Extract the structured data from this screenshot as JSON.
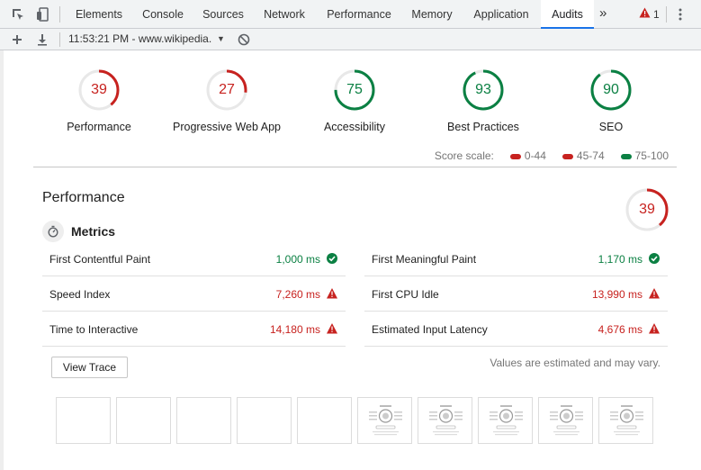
{
  "devtools": {
    "tabs": [
      {
        "label": "Elements",
        "active": false
      },
      {
        "label": "Console",
        "active": false
      },
      {
        "label": "Sources",
        "active": false
      },
      {
        "label": "Network",
        "active": false
      },
      {
        "label": "Performance",
        "active": false
      },
      {
        "label": "Memory",
        "active": false
      },
      {
        "label": "Application",
        "active": false
      },
      {
        "label": "Audits",
        "active": true
      }
    ],
    "more_tabs": "»",
    "warning_count": "1"
  },
  "toolbar": {
    "report_selector": "11:53:21 PM - www.wikipedia.",
    "caret": "▼"
  },
  "categories": [
    {
      "score": "39",
      "label": "Performance",
      "color": "#c7221f",
      "fraction": 0.39
    },
    {
      "score": "27",
      "label": "Progressive Web App",
      "color": "#c7221f",
      "fraction": 0.27
    },
    {
      "score": "75",
      "label": "Accessibility",
      "color": "#0b8043",
      "fraction": 0.75
    },
    {
      "score": "93",
      "label": "Best Practices",
      "color": "#0b8043",
      "fraction": 0.93
    },
    {
      "score": "90",
      "label": "SEO",
      "color": "#0b8043",
      "fraction": 0.9
    }
  ],
  "score_scale": {
    "label": "Score scale:",
    "ranges": [
      {
        "label": "0-44",
        "color": "#c7221f"
      },
      {
        "label": "45-74",
        "color": "#c7221f"
      },
      {
        "label": "75-100",
        "color": "#0b8043"
      }
    ]
  },
  "performance": {
    "title": "Performance",
    "score": "39",
    "fraction": 0.39,
    "metrics_title": "Metrics",
    "metrics": [
      {
        "label": "First Contentful Paint",
        "value": "1,000 ms",
        "status": "pass"
      },
      {
        "label": "First Meaningful Paint",
        "value": "1,170 ms",
        "status": "pass"
      },
      {
        "label": "Speed Index",
        "value": "7,260 ms",
        "status": "fail"
      },
      {
        "label": "First CPU Idle",
        "value": "13,990 ms",
        "status": "fail"
      },
      {
        "label": "Time to Interactive",
        "value": "14,180 ms",
        "status": "fail"
      },
      {
        "label": "Estimated Input Latency",
        "value": "4,676 ms",
        "status": "fail"
      }
    ],
    "view_trace_label": "View Trace",
    "estimate_note": "Values are estimated and may vary.",
    "filmstrip": [
      {
        "loaded": false
      },
      {
        "loaded": false
      },
      {
        "loaded": false
      },
      {
        "loaded": false
      },
      {
        "loaded": false
      },
      {
        "loaded": true
      },
      {
        "loaded": true
      },
      {
        "loaded": true
      },
      {
        "loaded": true
      },
      {
        "loaded": true
      }
    ]
  }
}
